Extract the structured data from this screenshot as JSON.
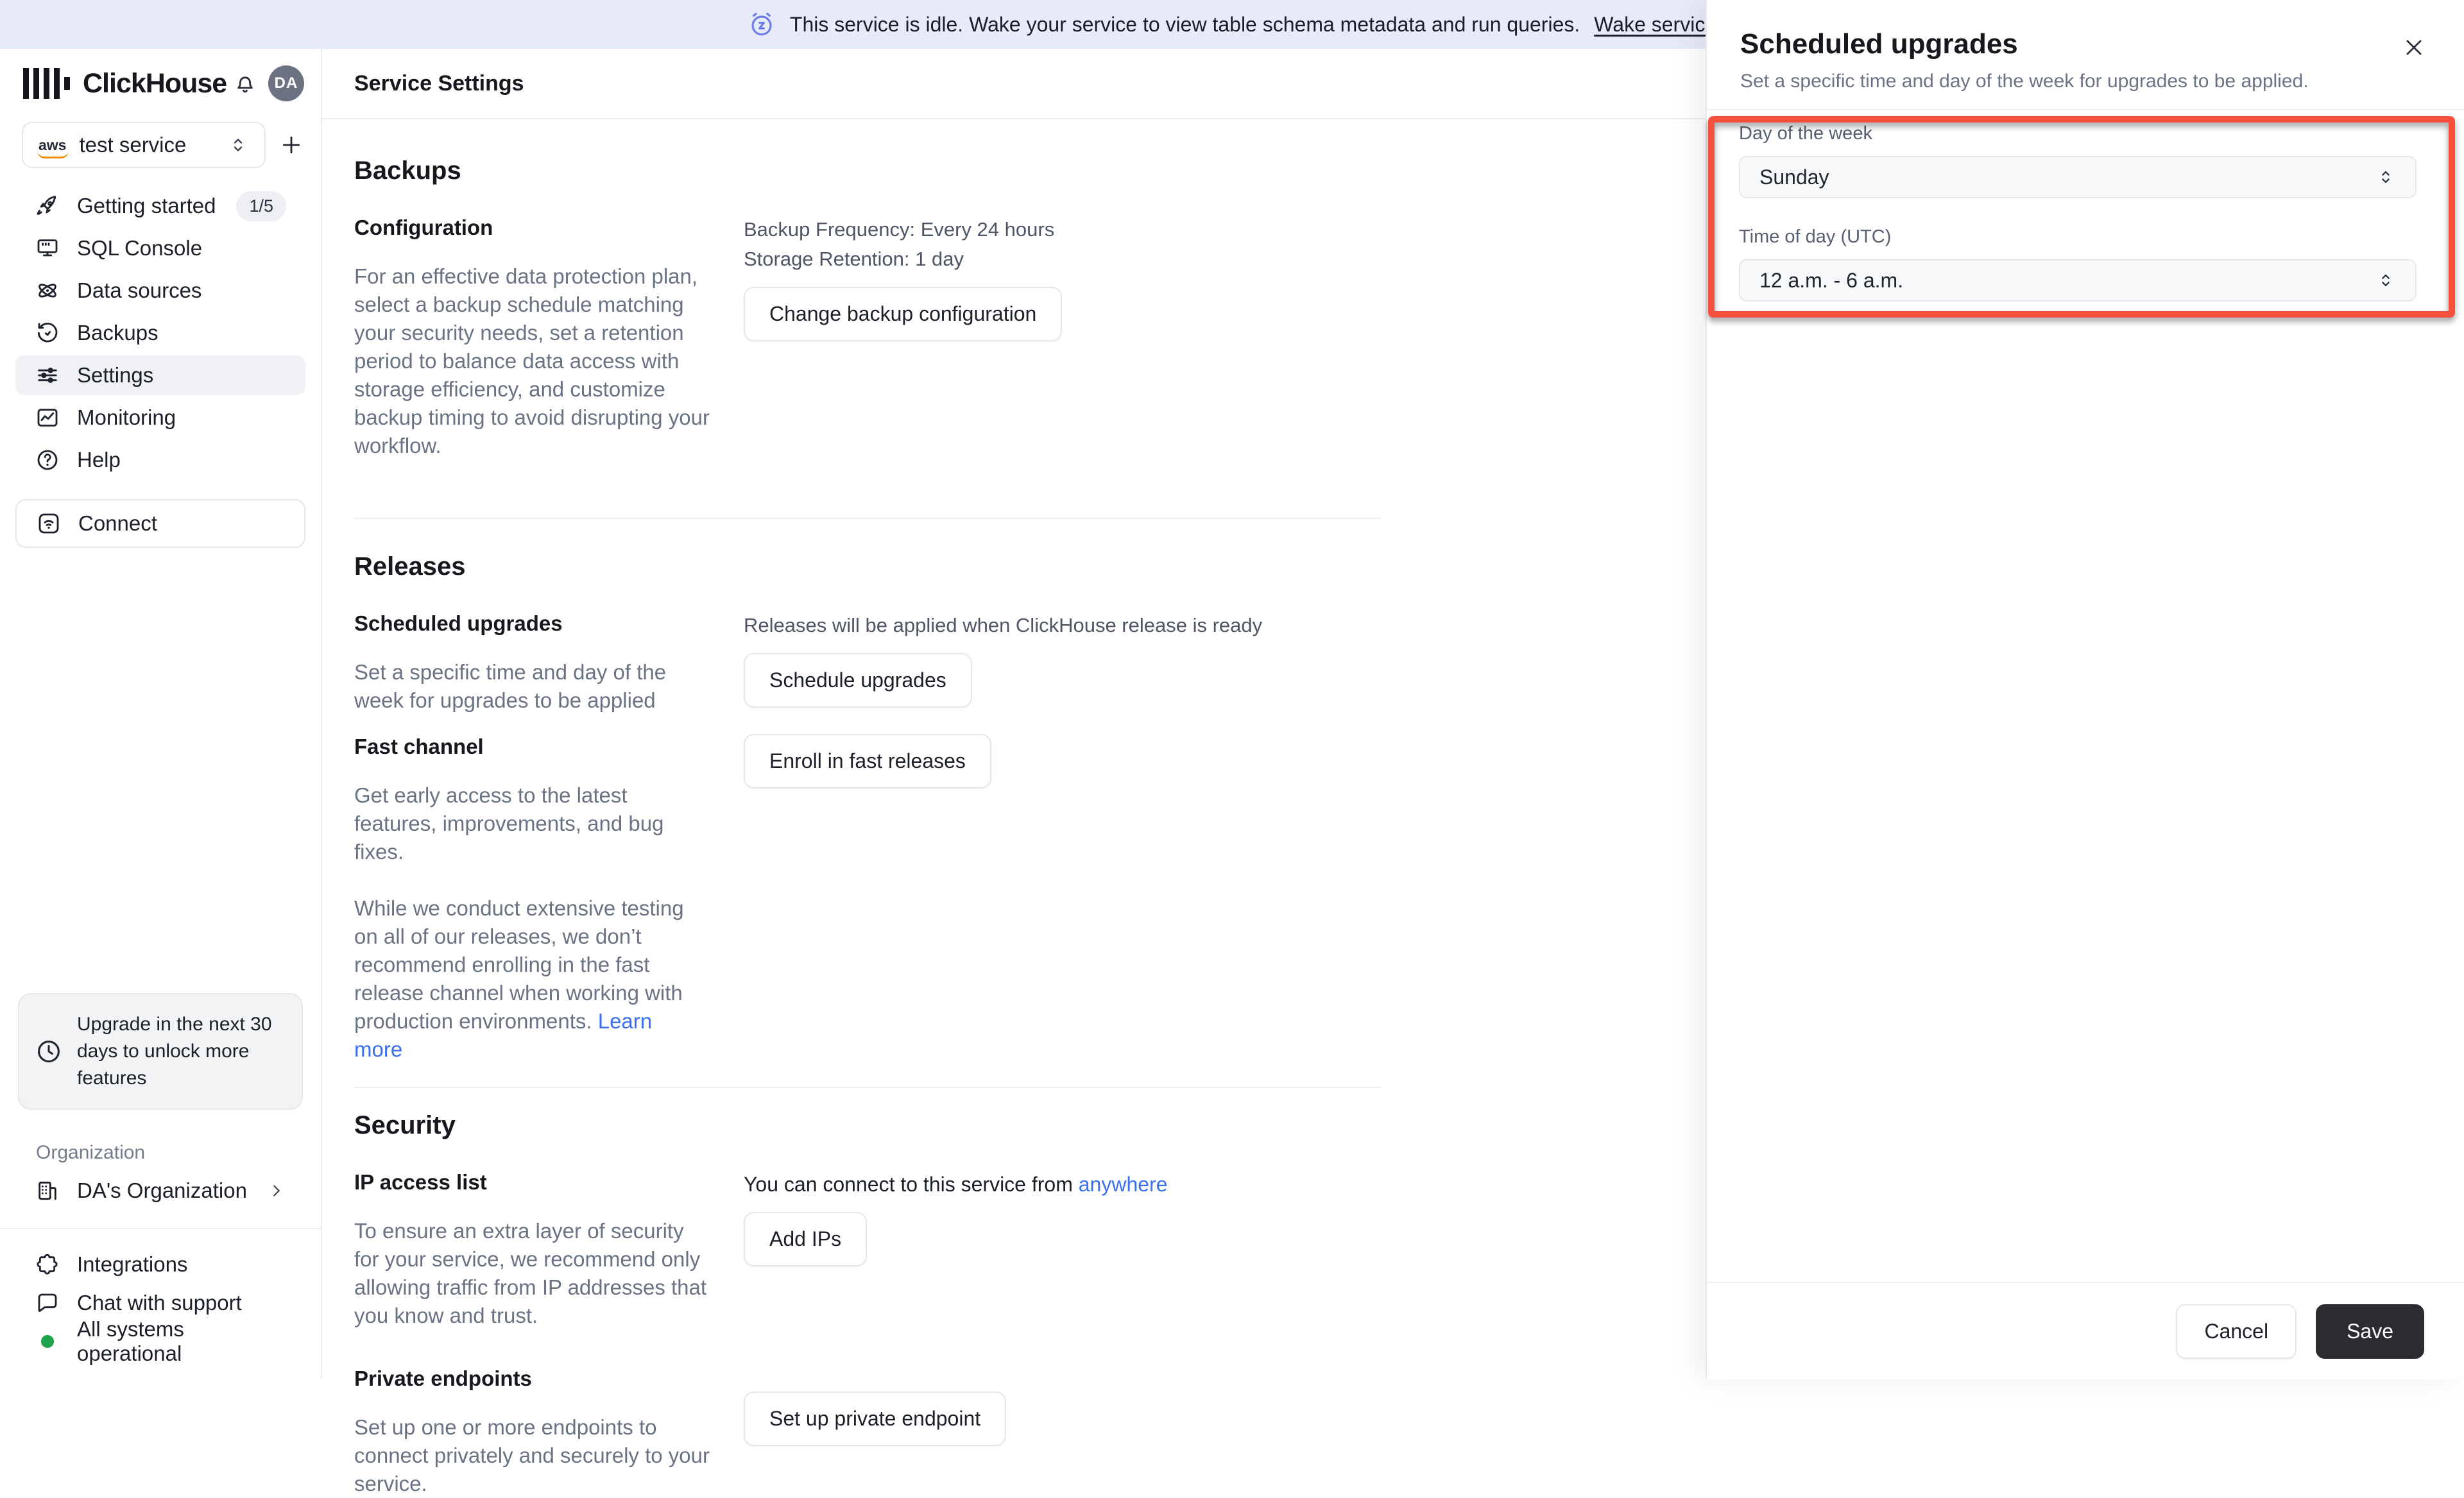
{
  "colors": {
    "accent_red": "#f4503c",
    "link_blue": "#3a6ff0",
    "banner_bg": "#e7eaf8",
    "save_button_bg": "#2a2c32",
    "status_green": "#1fa34d",
    "aws_orange": "#f29111"
  },
  "banner": {
    "text": "This service is idle. Wake your service to view table schema metadata and run queries.",
    "link": "Wake service"
  },
  "sidebar": {
    "brand": "ClickHouse",
    "avatar": "DA",
    "service": {
      "name": "test service",
      "provider": "aws"
    },
    "nav": [
      {
        "label": "Getting started",
        "badge": "1/5"
      },
      {
        "label": "SQL Console"
      },
      {
        "label": "Data sources"
      },
      {
        "label": "Backups"
      },
      {
        "label": "Settings"
      },
      {
        "label": "Monitoring"
      },
      {
        "label": "Help"
      }
    ],
    "connect_label": "Connect",
    "upgrade_note": "Upgrade in the next 30 days to unlock more features",
    "org_section_label": "Organization",
    "org_name": "DA's Organization",
    "footer_items": [
      {
        "label": "Integrations"
      },
      {
        "label": "Chat with support"
      },
      {
        "label": "All systems operational"
      }
    ]
  },
  "main": {
    "title": "Service Settings",
    "backups": {
      "heading": "Backups",
      "config_heading": "Configuration",
      "config_desc": "For an effective data protection plan, select a backup schedule matching your security needs, set a retention period to balance data access with storage efficiency, and customize backup timing to avoid disrupting your workflow.",
      "frequency": "Backup Frequency: Every 24 hours",
      "retention": "Storage Retention: 1 day",
      "change_btn": "Change backup configuration"
    },
    "releases": {
      "heading": "Releases",
      "scheduled_heading": "Scheduled upgrades",
      "scheduled_desc": "Set a specific time and day of the week for upgrades to be applied",
      "ready_text": "Releases will be applied when ClickHouse release is ready",
      "schedule_btn": "Schedule upgrades",
      "fast_heading": "Fast channel",
      "fast_desc1": "Get early access to the latest features, improvements, and bug fixes.",
      "fast_desc2": "While we conduct extensive testing on all of our releases, we don’t recommend enrolling in the fast release channel when working with production environments.",
      "learn_more": "Learn more",
      "enroll_btn": "Enroll in fast releases"
    },
    "security": {
      "heading": "Security",
      "ip_heading": "IP access list",
      "ip_desc": "To ensure an extra layer of security for your service, we recommend only allowing traffic from IP addresses that you know and trust.",
      "connect_text": "You can connect to this service from",
      "anywhere_link": "anywhere",
      "add_ips_btn": "Add IPs",
      "pe_heading": "Private endpoints",
      "pe_desc": "Set up one or more endpoints to connect privately and securely to your service.",
      "pe_btn": "Set up private endpoint"
    }
  },
  "drawer": {
    "title": "Scheduled upgrades",
    "subtitle": "Set a specific time and day of the week for upgrades to be applied.",
    "day_label": "Day of the week",
    "day_value": "Sunday",
    "time_label": "Time of day (UTC)",
    "time_value": "12 a.m. - 6 a.m.",
    "cancel_label": "Cancel",
    "save_label": "Save"
  }
}
